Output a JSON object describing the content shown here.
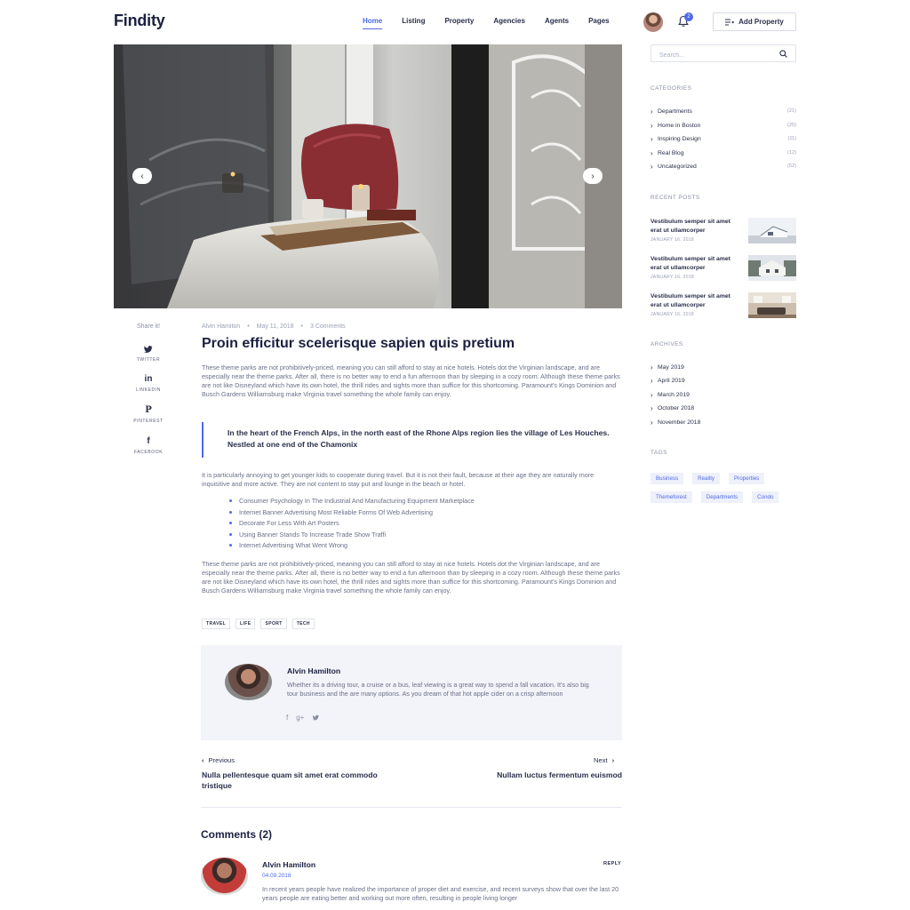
{
  "header": {
    "logo": "Findity",
    "nav": [
      "Home",
      "Listing",
      "Property",
      "Agencies",
      "Agents",
      "Pages"
    ],
    "active_nav": "Home",
    "notifications_count": "2",
    "add_property_label": "Add Property"
  },
  "share": {
    "title": "Share it!",
    "items": [
      {
        "label": "TWITTER",
        "icon": "twitter-icon"
      },
      {
        "label": "LINKEDIN",
        "icon": "linkedin-icon"
      },
      {
        "label": "PINTEREST",
        "icon": "pinterest-icon"
      },
      {
        "label": "FACEBOOK",
        "icon": "facebook-icon"
      }
    ]
  },
  "article": {
    "author": "Alvin Hamiton",
    "date": "May 11, 2018",
    "comments": "3 Comments",
    "title": "Proin efficitur scelerisque sapien quis pretium",
    "para1": "These theme parks are not prohibitively-priced, meaning you can still afford to stay at nice hotels. Hotels dot the Virginian landscape, and are especially near the theme parks. After all, there is no better way to end a fun afternoon than by sleeping in a cozy room. Although these theme parks are not like Disneyland which have its own hotel, the thrill rides and sights more than suffice for this shortcoming. Paramount's Kings Dominion and Busch Gardens Williamsburg make Virginia travel something the whole family can enjoy.",
    "quote": "In the heart of the French Alps, in the north east of the Rhone Alps region lies the village of Les Houches. Nestled at one end of the Chamonix",
    "para2": "It is particularly annoying to get younger kids to cooperate during travel. But it is not their fault, because at their age they are naturally more inquisitive and more active. They are not content to stay put and lounge in the beach or hotel.",
    "bullets": [
      "Consumer Psychology In The Industrial And Manufacturing  Equipment Marketplace",
      "Internet Banner Advertising Most Reliable Forms Of Web Advertising",
      "Decorate For Less With Art Posters",
      "Using Banner Stands To Increase Trade Show Traffi",
      "Internet Advertising What Went Wrong"
    ],
    "para3": "These theme parks are not prohibitively-priced, meaning you can still afford to stay at nice hotels. Hotels dot the Virginian landscape, and are especially near the theme parks. After all, there is no better way to end a fun afternoon than by sleeping in a cozy room. Although these theme parks are not like Disneyland which have its own hotel, the thrill rides and sights more than suffice for this shortcoming. Paramount's Kings Dominion and Busch Gardens Williamsburg make Virginia travel something the whole family can enjoy.",
    "post_tags": [
      "TRAVEL",
      "LIFE",
      "SPORT",
      "TECH"
    ]
  },
  "author_box": {
    "name": "Alvin Hamilton",
    "bio": "Whether its a driving tour, a cruise or a bus, leaf viewing is a great way to spend a fall vacation. It's also big tour business and the are many options. As you dream of that hot apple cider on a crisp afternoon",
    "social": [
      "f",
      "g+"
    ]
  },
  "post_nav": {
    "prev_label": "Previous",
    "prev_title": "Nulla pellentesque quam sit amet erat commodo tristique",
    "next_label": "Next",
    "next_title": "Nullam luctus fermentum euismod"
  },
  "comments": {
    "title": "Comments (2)",
    "items": [
      {
        "name": "Alvin Hamilton",
        "date": "04.09.2018",
        "reply": "REPLY",
        "text": "In recent years people have realized the importance of proper diet and exercise, and recent surveys show that over the last 20 years people are eating better and working out more often, resulting in people living longer"
      }
    ]
  },
  "sidebar": {
    "search_placeholder": "Search...",
    "categories_title": "CATEGORIES",
    "categories": [
      {
        "name": "Departments",
        "count": "(21)"
      },
      {
        "name": "Home in Boston",
        "count": "(25)"
      },
      {
        "name": "Inspiring Design",
        "count": "(11)"
      },
      {
        "name": "Real Blog",
        "count": "(12)"
      },
      {
        "name": "Uncategorized",
        "count": "(52)"
      }
    ],
    "recent_title": "RECENT POSTS",
    "recent_posts": [
      {
        "title": "Vestibulum semper sit amet erat ut ullamcorper",
        "date": "JANUARY 16, 2018"
      },
      {
        "title": "Vestibulum semper sit amet erat ut ullamcorper",
        "date": "JANUARY 16, 2018"
      },
      {
        "title": "Vestibulum semper sit amet erat ut ullamcorper",
        "date": "JANUARY 16, 2018"
      }
    ],
    "archives_title": "ARCHIVES",
    "archives": [
      "May 2019",
      "April 2019",
      "March 2019",
      "October 2018",
      "November 2018"
    ],
    "tags_title": "TAGS",
    "tags": [
      "Business",
      "Reality",
      "Properties",
      "Themeforest",
      "Departments",
      "Condo"
    ]
  },
  "colors": {
    "accent": "#4f6ae6",
    "heading": "#1b2040",
    "body_text": "#6a6f88",
    "author_box_bg": "#f3f4f9"
  }
}
